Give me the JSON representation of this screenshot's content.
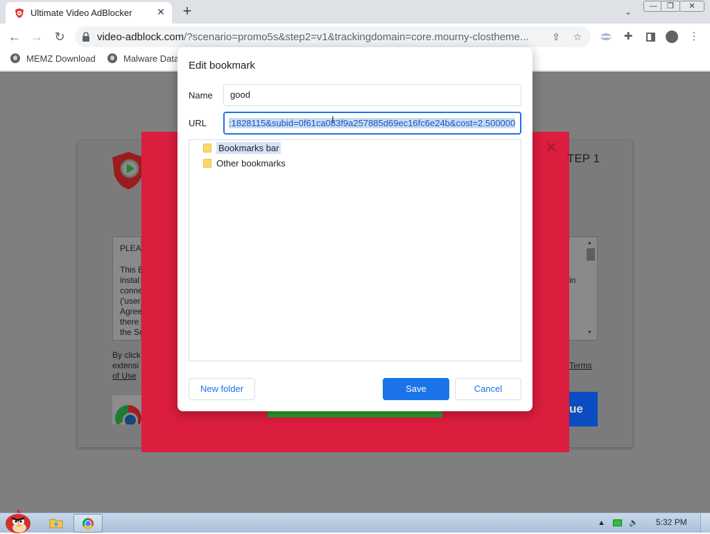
{
  "browser": {
    "tab": {
      "title": "Ultimate Video AdBlocker"
    },
    "window_controls": {
      "minimize": "—",
      "restore": "❐",
      "close": "✕"
    },
    "address": {
      "host": "video-adblock.com",
      "path": "/?scenario=promo5s&step2=v1&trackingdomain=core.mourny-clostheme..."
    },
    "bookmarks": [
      {
        "label": "MEMZ Download"
      },
      {
        "label": "Malware Data"
      }
    ]
  },
  "page": {
    "step_label": "TEP 1",
    "eula_title": "PLEA",
    "eula_lines": [
      "This E",
      "instal",
      "conne",
      "('user",
      "Agree",
      "there",
      "the So"
    ],
    "eula_right_text": "in",
    "by_click_lines": [
      "By click",
      "extensi",
      "of Use"
    ],
    "terms_link": "Terms",
    "continue_label": "ue"
  },
  "dialog": {
    "title": "Edit bookmark",
    "name_label": "Name",
    "name_value": "good",
    "url_label": "URL",
    "url_value": ":1828115&subid=0f61ca083f9a257885d69ec16fc6e24b&cost=2.500000",
    "folders": [
      {
        "label": "Bookmarks bar",
        "selected": true
      },
      {
        "label": "Other bookmarks",
        "selected": false
      }
    ],
    "new_folder_label": "New folder",
    "save_label": "Save",
    "cancel_label": "Cancel"
  },
  "taskbar": {
    "time": "5:32 PM"
  },
  "colors": {
    "accent": "#1a73e8",
    "red_panel": "#db1d3e",
    "page_dim": "#7f7f7f"
  }
}
